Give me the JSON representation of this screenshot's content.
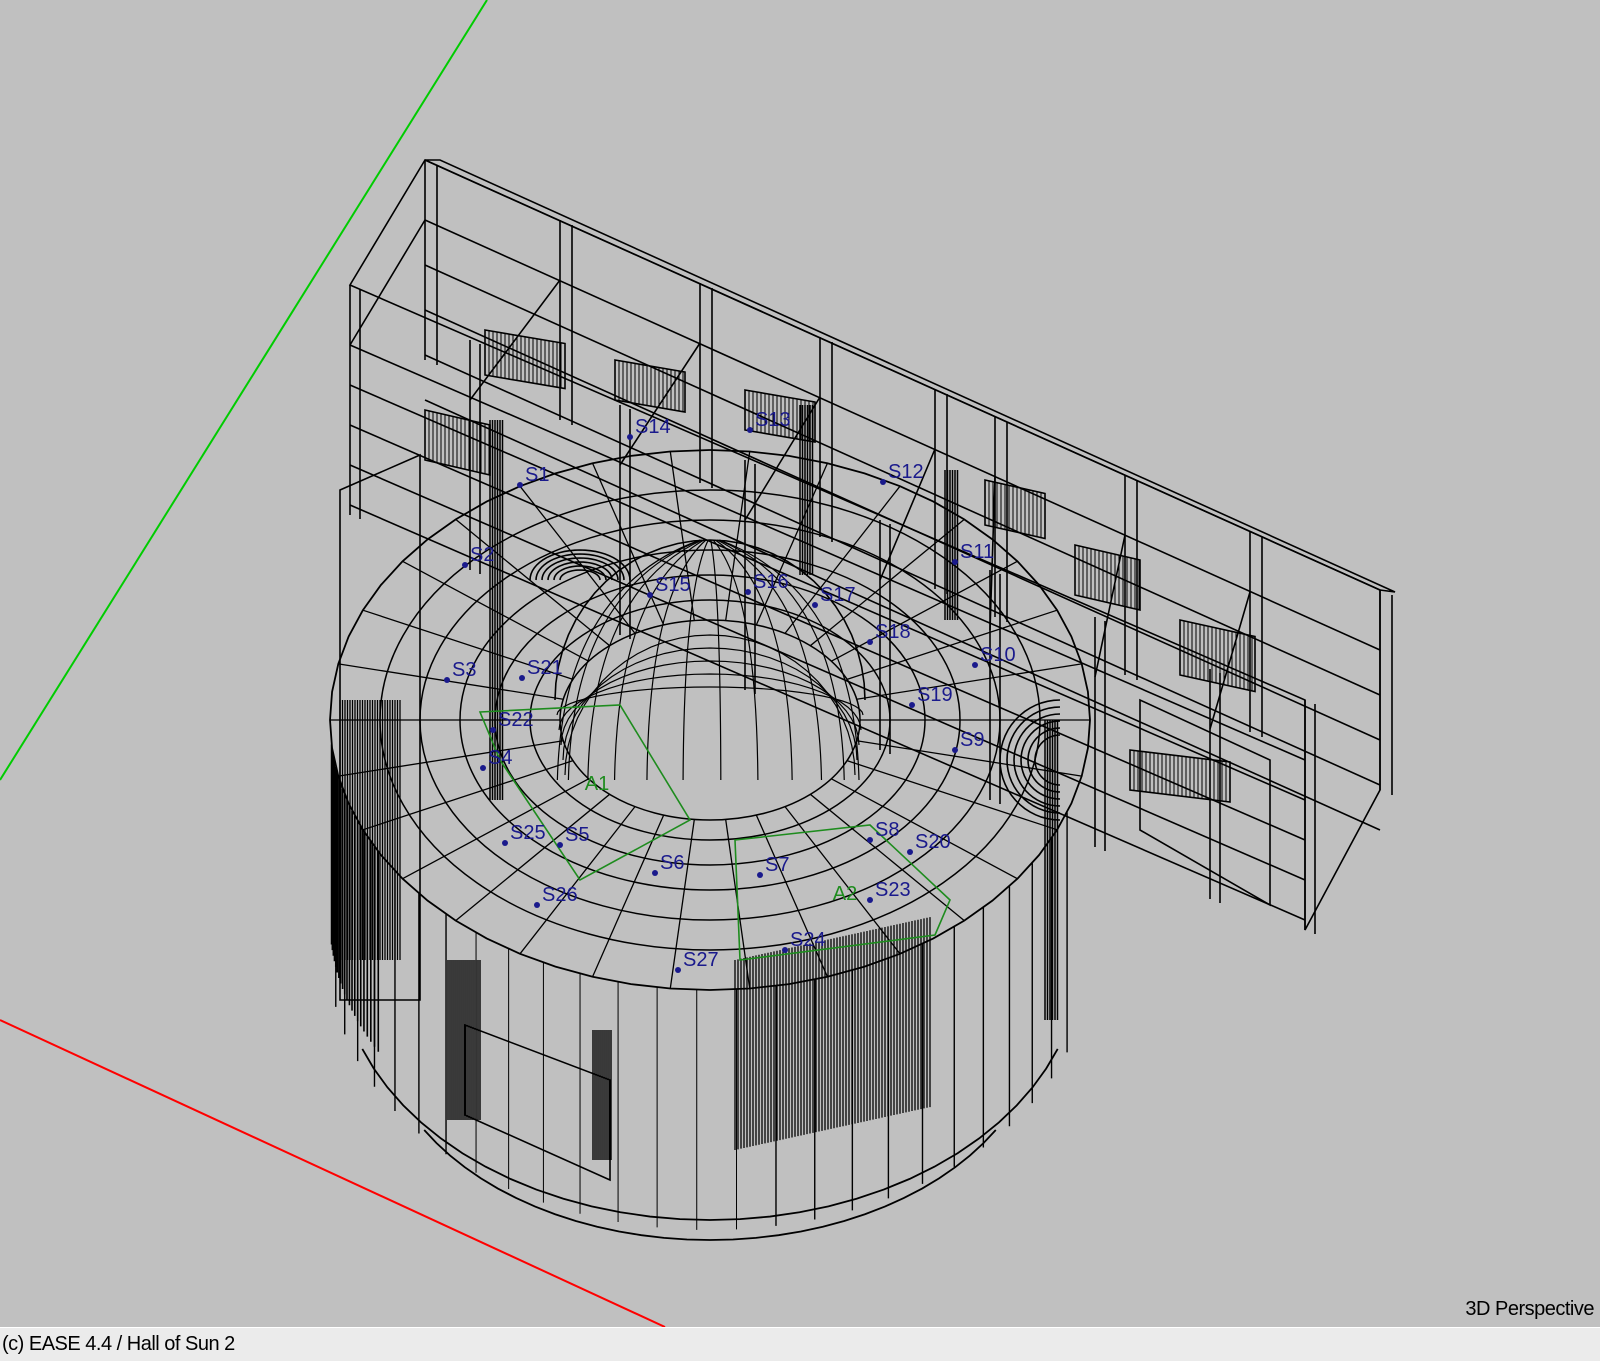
{
  "viewport": {
    "view_mode": "3D Perspective",
    "axis_colors": {
      "x_axis": "#ff0000",
      "y_axis": "#00cc00"
    },
    "wire_color": "#000000",
    "source_label_color": "#1a1a8c",
    "audience_area_color": "#1e8c1e",
    "sources": [
      "S1",
      "S2",
      "S3",
      "S4",
      "S5",
      "S6",
      "S7",
      "S8",
      "S9",
      "S10",
      "S11",
      "S12",
      "S13",
      "S14",
      "S15",
      "S16",
      "S17",
      "S18",
      "S19",
      "S20",
      "S21",
      "S22",
      "S23",
      "S24",
      "S25",
      "S26",
      "S27"
    ],
    "audience_areas": [
      "A1",
      "A2"
    ]
  },
  "statusbar": {
    "text": "(c) EASE 4.4  / Hall of Sun 2"
  }
}
